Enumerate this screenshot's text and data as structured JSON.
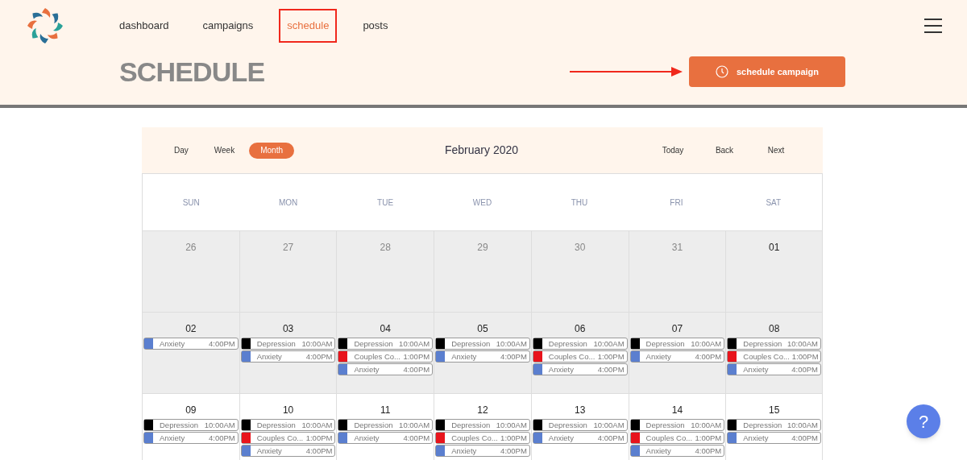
{
  "nav": [
    {
      "label": "dashboard",
      "selected": false
    },
    {
      "label": "campaigns",
      "selected": false
    },
    {
      "label": "schedule",
      "selected": true
    },
    {
      "label": "posts",
      "selected": false
    }
  ],
  "page_title": "SCHEDULE",
  "action_button": "schedule campaign",
  "calendar": {
    "views": [
      {
        "label": "Day",
        "selected": false
      },
      {
        "label": "Week",
        "selected": false
      },
      {
        "label": "Month",
        "selected": true
      }
    ],
    "title": "February 2020",
    "nav_buttons": [
      "Today",
      "Back",
      "Next"
    ],
    "weekdays": [
      "SUN",
      "MON",
      "TUE",
      "WED",
      "THU",
      "FRI",
      "SAT"
    ],
    "weeks": [
      {
        "shaded": true,
        "days": [
          {
            "date": "26",
            "muted": true
          },
          {
            "date": "27",
            "muted": true
          },
          {
            "date": "28",
            "muted": true
          },
          {
            "date": "29",
            "muted": true
          },
          {
            "date": "30",
            "muted": true
          },
          {
            "date": "31",
            "muted": true
          },
          {
            "date": "01",
            "muted": false
          }
        ]
      },
      {
        "shaded": true,
        "days": [
          {
            "date": "02",
            "muted": false,
            "events": [
              {
                "title": "Anxiety",
                "time": "4:00PM",
                "color": "#5b7fcf"
              }
            ]
          },
          {
            "date": "03",
            "muted": false,
            "events": [
              {
                "title": "Depression",
                "time": "10:00AM",
                "color": "#000000"
              },
              {
                "title": "Anxiety",
                "time": "4:00PM",
                "color": "#5b7fcf"
              }
            ]
          },
          {
            "date": "04",
            "muted": false,
            "events": [
              {
                "title": "Depression",
                "time": "10:00AM",
                "color": "#000000"
              },
              {
                "title": "Couples Co...",
                "time": "1:00PM",
                "color": "#e8141c"
              },
              {
                "title": "Anxiety",
                "time": "4:00PM",
                "color": "#5b7fcf"
              }
            ]
          },
          {
            "date": "05",
            "muted": false,
            "events": [
              {
                "title": "Depression",
                "time": "10:00AM",
                "color": "#000000"
              },
              {
                "title": "Anxiety",
                "time": "4:00PM",
                "color": "#5b7fcf"
              }
            ]
          },
          {
            "date": "06",
            "muted": false,
            "events": [
              {
                "title": "Depression",
                "time": "10:00AM",
                "color": "#000000"
              },
              {
                "title": "Couples Co...",
                "time": "1:00PM",
                "color": "#e8141c"
              },
              {
                "title": "Anxiety",
                "time": "4:00PM",
                "color": "#5b7fcf"
              }
            ]
          },
          {
            "date": "07",
            "muted": false,
            "events": [
              {
                "title": "Depression",
                "time": "10:00AM",
                "color": "#000000"
              },
              {
                "title": "Anxiety",
                "time": "4:00PM",
                "color": "#5b7fcf"
              }
            ]
          },
          {
            "date": "08",
            "muted": false,
            "events": [
              {
                "title": "Depression",
                "time": "10:00AM",
                "color": "#000000"
              },
              {
                "title": "Couples Co...",
                "time": "1:00PM",
                "color": "#e8141c"
              },
              {
                "title": "Anxiety",
                "time": "4:00PM",
                "color": "#5b7fcf"
              }
            ]
          }
        ]
      },
      {
        "shaded": false,
        "days": [
          {
            "date": "09",
            "muted": false,
            "events": [
              {
                "title": "Depression",
                "time": "10:00AM",
                "color": "#000000"
              },
              {
                "title": "Anxiety",
                "time": "4:00PM",
                "color": "#5b7fcf"
              }
            ]
          },
          {
            "date": "10",
            "muted": false,
            "events": [
              {
                "title": "Depression",
                "time": "10:00AM",
                "color": "#000000"
              },
              {
                "title": "Couples Co...",
                "time": "1:00PM",
                "color": "#e8141c"
              },
              {
                "title": "Anxiety",
                "time": "4:00PM",
                "color": "#5b7fcf"
              }
            ]
          },
          {
            "date": "11",
            "muted": false,
            "events": [
              {
                "title": "Depression",
                "time": "10:00AM",
                "color": "#000000"
              },
              {
                "title": "Anxiety",
                "time": "4:00PM",
                "color": "#5b7fcf"
              }
            ]
          },
          {
            "date": "12",
            "muted": false,
            "events": [
              {
                "title": "Depression",
                "time": "10:00AM",
                "color": "#000000"
              },
              {
                "title": "Couples Co...",
                "time": "1:00PM",
                "color": "#e8141c"
              },
              {
                "title": "Anxiety",
                "time": "4:00PM",
                "color": "#5b7fcf"
              }
            ]
          },
          {
            "date": "13",
            "muted": false,
            "events": [
              {
                "title": "Depression",
                "time": "10:00AM",
                "color": "#000000"
              },
              {
                "title": "Anxiety",
                "time": "4:00PM",
                "color": "#5b7fcf"
              }
            ]
          },
          {
            "date": "14",
            "muted": false,
            "events": [
              {
                "title": "Depression",
                "time": "10:00AM",
                "color": "#000000"
              },
              {
                "title": "Couples Co...",
                "time": "1:00PM",
                "color": "#e8141c"
              },
              {
                "title": "Anxiety",
                "time": "4:00PM",
                "color": "#5b7fcf"
              }
            ]
          },
          {
            "date": "15",
            "muted": false,
            "events": [
              {
                "title": "Depression",
                "time": "10:00AM",
                "color": "#000000"
              },
              {
                "title": "Anxiety",
                "time": "4:00PM",
                "color": "#5b7fcf"
              }
            ]
          }
        ]
      }
    ]
  },
  "help_button": "?"
}
